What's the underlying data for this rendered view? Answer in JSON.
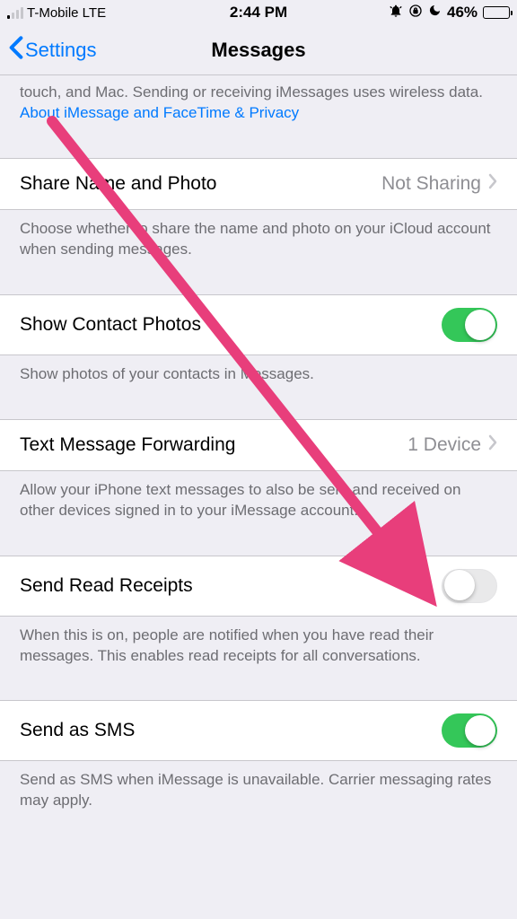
{
  "status": {
    "carrier": "T-Mobile LTE",
    "time": "2:44 PM",
    "battery_pct": "46%"
  },
  "nav": {
    "back_label": "Settings",
    "title": "Messages"
  },
  "imessage_footer_part1": "touch, and Mac. Sending or receiving iMessages uses wireless data. ",
  "imessage_footer_link": "About iMessage and FaceTime & Privacy",
  "rows": {
    "share": {
      "label": "Share Name and Photo",
      "value": "Not Sharing"
    },
    "share_footer": "Choose whether to share the name and photo on your iCloud account when sending messages.",
    "contacts": {
      "label": "Show Contact Photos",
      "on": true
    },
    "contacts_footer": "Show photos of your contacts in Messages.",
    "forwarding": {
      "label": "Text Message Forwarding",
      "value": "1 Device"
    },
    "forwarding_footer": "Allow your iPhone text messages to also be sent and received on other devices signed in to your iMessage account.",
    "receipts": {
      "label": "Send Read Receipts",
      "on": false
    },
    "receipts_footer": "When this is on, people are notified when you have read their messages. This enables read receipts for all conversations.",
    "sms": {
      "label": "Send as SMS",
      "on": true
    },
    "sms_footer": "Send as SMS when iMessage is unavailable. Carrier messaging rates may apply."
  },
  "annotation": {
    "color": "#e83e7b"
  }
}
